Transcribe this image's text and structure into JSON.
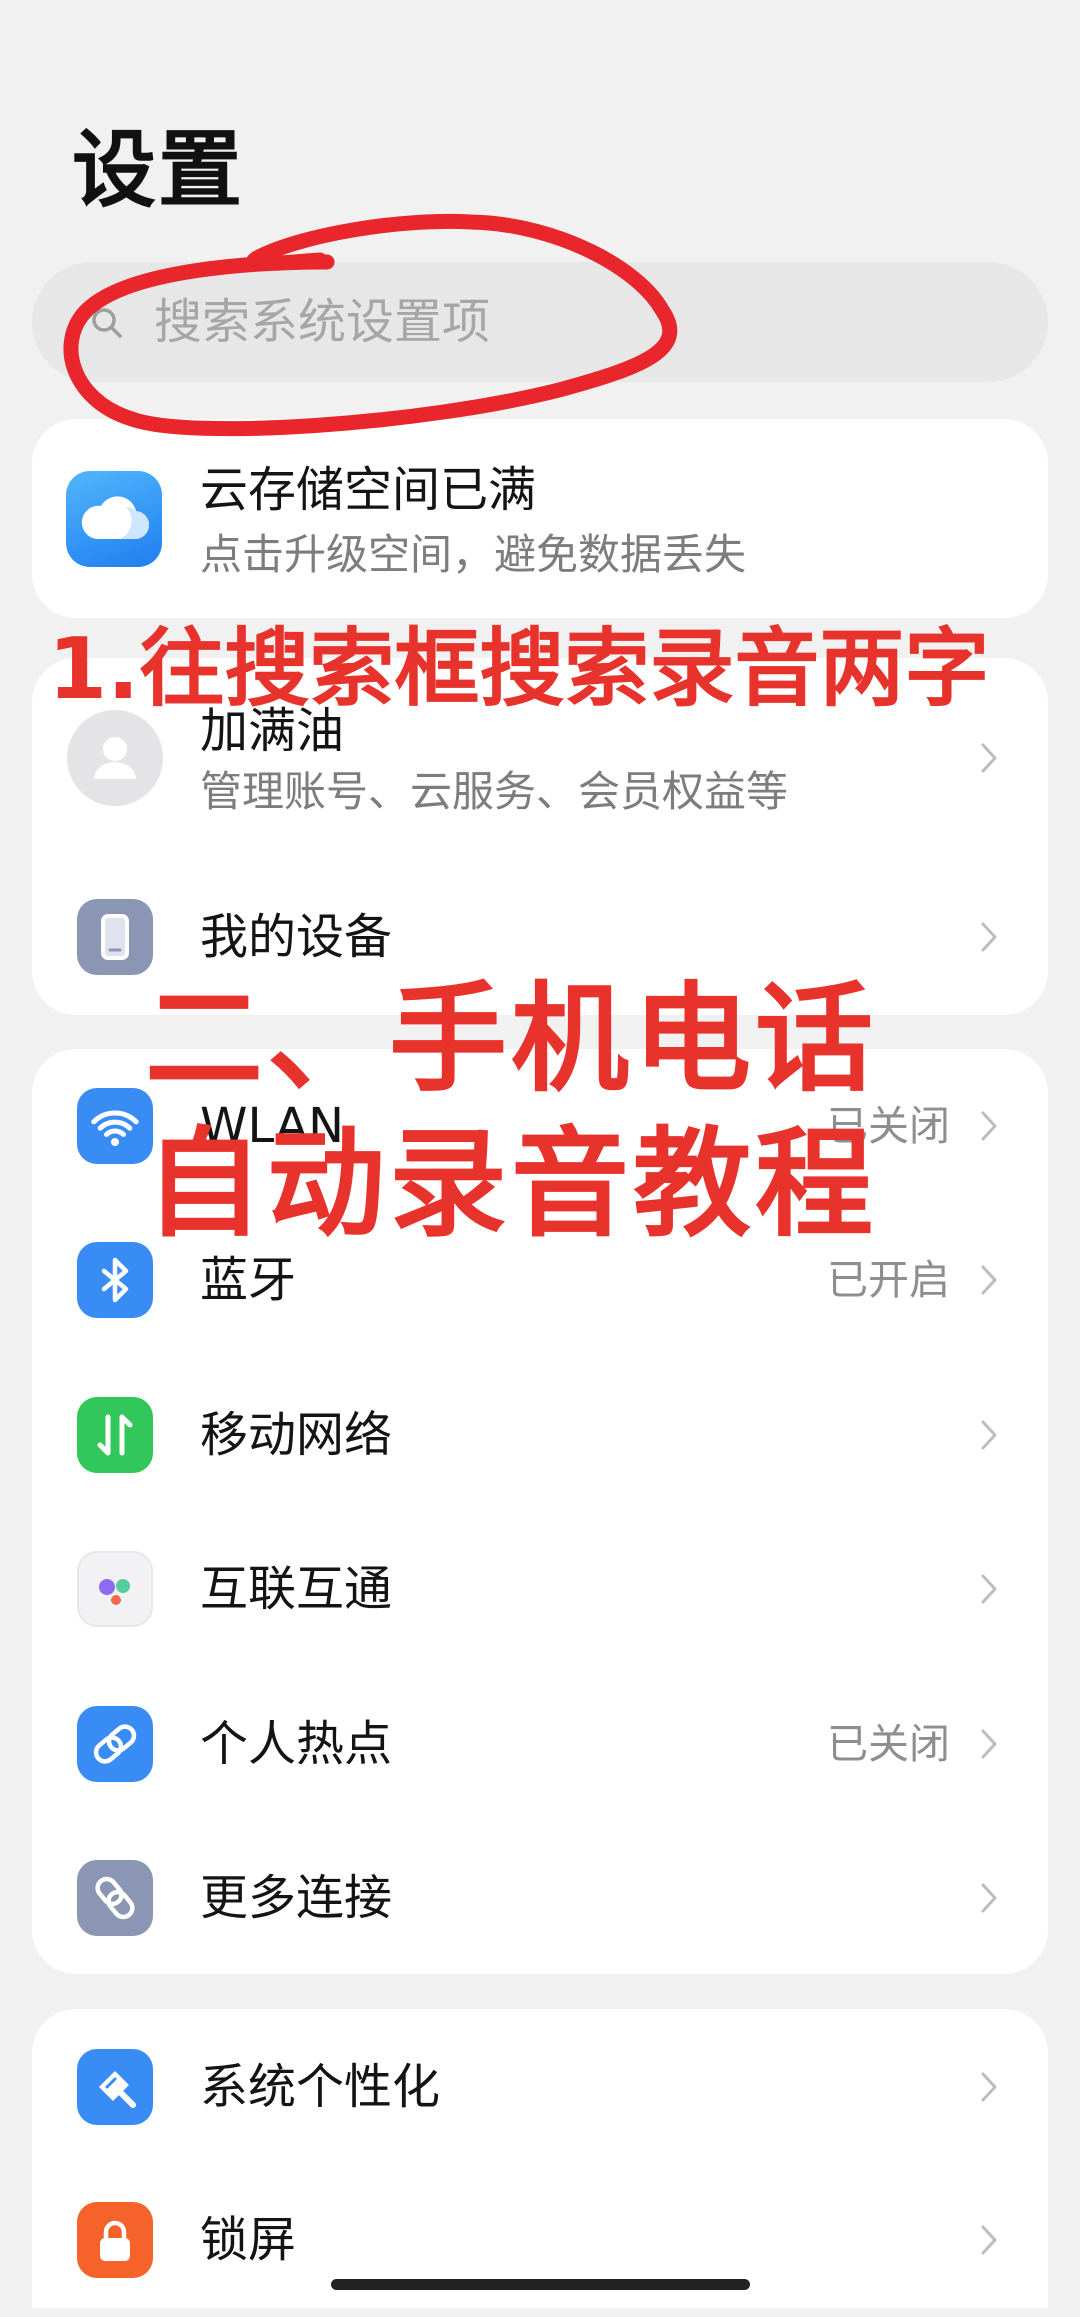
{
  "page": {
    "title": "设置"
  },
  "search": {
    "placeholder": "搜索系统设置项",
    "icon": "search-icon"
  },
  "cloud_banner": {
    "icon": "cloud-icon",
    "title": "云存储空间已满",
    "subtitle": "点击升级空间，避免数据丢失"
  },
  "account": {
    "icon": "avatar-icon",
    "name": "加满油",
    "subtitle": "管理账号、云服务、会员权益等"
  },
  "device": {
    "icon": "phone-icon",
    "label": "我的设备"
  },
  "connectivity": {
    "items": [
      {
        "label": "WLAN",
        "status": "已关闭",
        "icon": "wifi-icon",
        "icon_color": "#3a8cf5"
      },
      {
        "label": "蓝牙",
        "status": "已开启",
        "icon": "bluetooth-icon",
        "icon_color": "#3a8cf5"
      },
      {
        "label": "移动网络",
        "icon": "mobile-data-icon",
        "icon_color": "#32c75a"
      },
      {
        "label": "互联互通",
        "icon": "interconnect-icon",
        "icon_color": "#f2f2f4"
      },
      {
        "label": "个人热点",
        "status": "已关闭",
        "icon": "hotspot-icon",
        "icon_color": "#3a8cf5"
      },
      {
        "label": "更多连接",
        "icon": "more-connections-icon",
        "icon_color": "#8b95b4"
      }
    ]
  },
  "display": {
    "items": [
      {
        "label": "系统个性化",
        "icon": "personalization-icon",
        "icon_color": "#3a8cf5"
      },
      {
        "label": "锁屏",
        "icon": "lock-icon",
        "icon_color": "#f5622a"
      }
    ]
  },
  "annotations": {
    "step1": "1.往搜索框搜索录音两字",
    "heading_line1": "二、手机电话",
    "heading_line2": "自动录音教程",
    "color": "#e8332c"
  },
  "colors": {
    "background": "#f1f1f1",
    "card": "#ffffff",
    "accent": "#3a8cf5",
    "secondary_text": "#8e8e8e"
  }
}
